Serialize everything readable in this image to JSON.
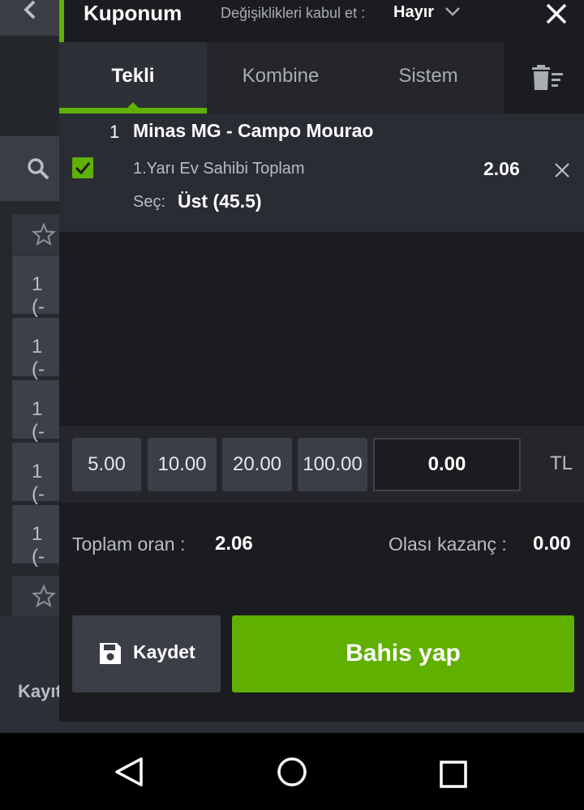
{
  "background": {
    "rows": [
      "1 (-",
      "1 (-",
      "1 (-",
      "1 (-",
      "1 (-"
    ],
    "register_text": "Kayıt"
  },
  "header": {
    "title": "Kuponum",
    "accept_changes_label": "Değişiklikleri kabul et :",
    "accept_changes_value": "Hayır"
  },
  "tabs": [
    {
      "label": "Tekli",
      "active": true
    },
    {
      "label": "Kombine",
      "active": false
    },
    {
      "label": "Sistem",
      "active": false
    }
  ],
  "bet": {
    "index": "1",
    "match": "Minas MG - Campo Mourao",
    "market": "1.Yarı Ev Sahibi Toplam",
    "odds": "2.06",
    "selection_label": "Seç:",
    "selection_value": "Üst (45.5)",
    "checked": true
  },
  "stake": {
    "chips": [
      "5.00",
      "10.00",
      "20.00",
      "100.00"
    ],
    "amount": "0.00",
    "currency": "TL"
  },
  "summary": {
    "total_odds_label": "Toplam oran :",
    "total_odds_value": "2.06",
    "potential_win_label": "Olası kazanç :",
    "potential_win_value": "0.00"
  },
  "actions": {
    "save_label": "Kaydet",
    "bet_label": "Bahis yap"
  },
  "colors": {
    "accent": "#5fb000",
    "panel_bg": "#1b1c20",
    "card_bg": "#2a2c33"
  },
  "icons": {
    "back": "chevron-left-icon",
    "search": "search-icon",
    "star": "star-icon",
    "close": "close-icon",
    "chevron": "chevron-down-icon",
    "trash": "trash-icon",
    "check": "checkbox-checked-icon",
    "remove": "remove-icon",
    "save": "floppy-disk-icon"
  }
}
